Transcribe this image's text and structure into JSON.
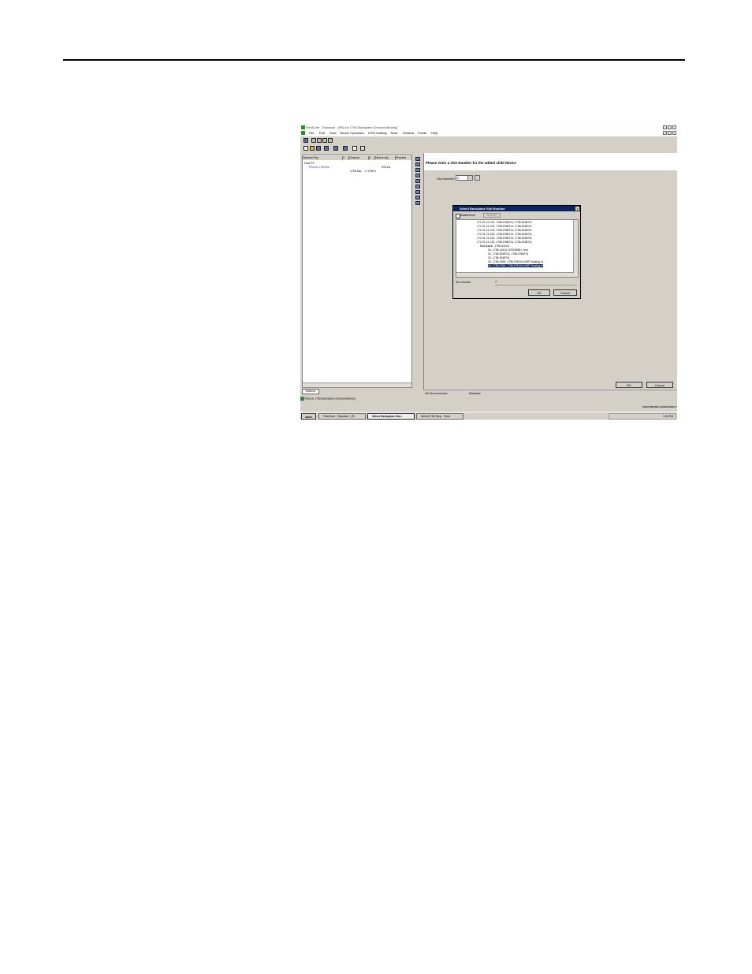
{
  "window": {
    "title": "FieldCare - Standard - [RSLinx 1756 Backplane (DeviceAddress)]"
  },
  "menu": [
    "File",
    "Edit",
    "View",
    "Device Operation",
    "DTM Catalog",
    "Tools",
    "Window",
    "Extras",
    "Help"
  ],
  "tree": {
    "columns": [
      "Network Tag",
      "C",
      "Channel",
      "A",
      "Device tag",
      "Physical"
    ],
    "rows": [
      {
        "tag": "Host PC",
        "col2": ""
      },
      {
        "tag": "RSLinx 1756 Ba...",
        "col2": "RSLinx"
      },
      {
        "tag": "",
        "col2": "1756 bac ... 0  1756 b"
      }
    ],
    "network_tab": "Network",
    "selection_status": "RSLinx 1756 Backplane (DeviceAddress)"
  },
  "right_panel": {
    "header": "Please enter a Slot Number for the added child device",
    "slot_label": "Slot Number:",
    "slot_value": "0",
    "ok_label": "OK",
    "cancel_label": "Cancel"
  },
  "dialog": {
    "title": "Select Backplane Slot Number",
    "checkbox_label": "disableScan",
    "disabled_btn": "Refresh",
    "items": [
      "172.31.21.222, 1756-ENBT/A, 1756-ENBT/A",
      "172.31.21.223, 1756-ENBT/A, 1756-ENBT/A",
      "172.31.21.224, 1756-ENBT/A, 1756-ENBT/A",
      "172.31.21.225, 1756-ENBT/A, 1756-ENBT/A",
      "172.31.21.226, 1756-ENBT/A, 1756-ENBT/A",
      "172.31.21.229, 1756-ENBT/A, 1756-ENBT/A",
      "Backplane, 1756-A10/A",
      "00, 1756-L61/A LOGIX5561, test",
      "01, 1756-ENBT/A, 1756-ENBT/A",
      "02, 1756-ENBT/A",
      "03, 1756-IF8H, 1756-IF8H/A HART Analog In",
      "04, 1756-IF8H, 1756-IF8H/A HART Analog In"
    ],
    "selected_index": 11,
    "slot_label": "Slot Number",
    "slot_value": "4",
    "ok_label": "OK",
    "cancel_label": "Cancel"
  },
  "status_bar": {
    "connection": "NO file connection",
    "database": "Database"
  },
  "user_status": "Administrator  Administrator /",
  "taskbar": {
    "start": "start",
    "tasks": [
      "FieldCare - Standard - [R...",
      "Select Backplane Slot...",
      "Select1756 Step - Paint"
    ],
    "active_index": 1,
    "clock": "1:06 PM"
  },
  "colors": {
    "selection": "#0a246a",
    "window_bg": "#d4d0c8"
  }
}
